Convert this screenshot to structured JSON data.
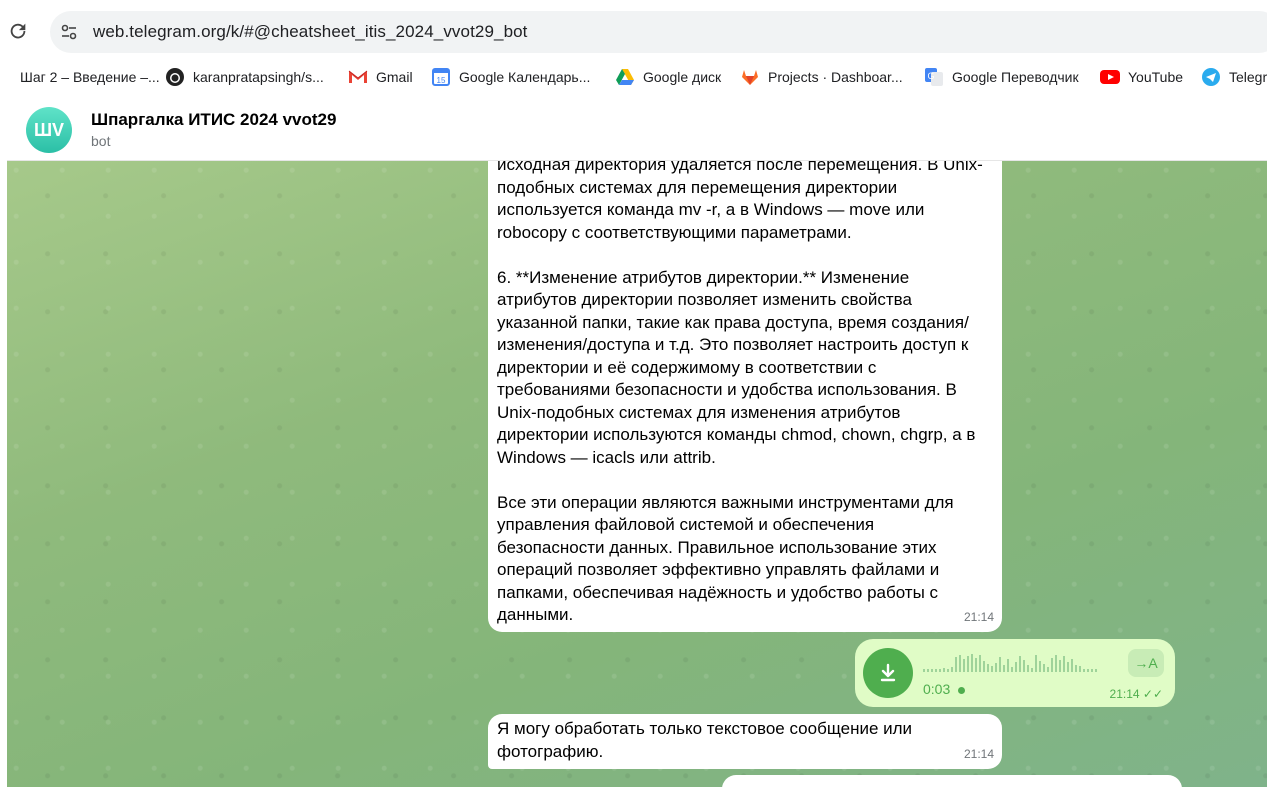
{
  "browser": {
    "url": "web.telegram.org/k/#@cheatsheet_itis_2024_vvot29_bot",
    "reload_icon": "reload-icon",
    "site_info_icon": "tune-icon"
  },
  "bookmarks": [
    {
      "label": "Шаг 2 – Введение –...",
      "icon": "page-icon"
    },
    {
      "label": "karanpratapsingh/s...",
      "icon": "github-icon"
    },
    {
      "label": "Gmail",
      "icon": "gmail-icon"
    },
    {
      "label": "Google Календарь...",
      "icon": "calendar-icon"
    },
    {
      "label": "Google диск",
      "icon": "drive-icon"
    },
    {
      "label": "Projects · Dashboar...",
      "icon": "gitlab-icon"
    },
    {
      "label": "Google Переводчик",
      "icon": "translate-icon"
    },
    {
      "label": "YouTube",
      "icon": "youtube-icon"
    },
    {
      "label": "Telegra",
      "icon": "telegram-icon"
    }
  ],
  "chat": {
    "avatar_initials": "ШV",
    "title": "Шпаргалка ИТИС 2024 vvot29",
    "subtitle": "bot"
  },
  "messages": {
    "long_text": "исходная директория удаляется после перемещения. В Unix-\nподобных системах для перемещения директории\nиспользуется команда mv -r, а в Windows — move или\nrobocopy с соответствующими параметрами.\n\n6. **Изменение атрибутов директории.** Изменение\nатрибутов директории позволяет изменить свойства\nуказанной папки, такие как права доступа, время создания/\nизменения/доступа и т.д. Это позволяет настроить доступ к\nдиректории и её содержимому в соответствии с\nтребованиями безопасности и удобства использования. В\nUnix-подобных системах для изменения атрибутов\nдиректории используются команды chmod, chown, chgrp, а в\nWindows — icacls или attrib.\n\nВсе эти операции являются важными инструментами для\nуправления файловой системой и обеспечения\nбезопасности данных. Правильное использование этих\nопераций позволяет эффективно управлять файлами и\nпапками, обеспечивая надёжность и удобство работы с\nданными.",
    "long_time": "21:14",
    "voice": {
      "duration": "0:03",
      "time": "21:14",
      "transcribe_label": "→A",
      "colors": {
        "bubble": "#e0fcc6",
        "accent": "#4fae4e"
      }
    },
    "short_text": "Я могу обработать только текстовое сообщение или\nфотографию.",
    "short_time": "21:14"
  }
}
